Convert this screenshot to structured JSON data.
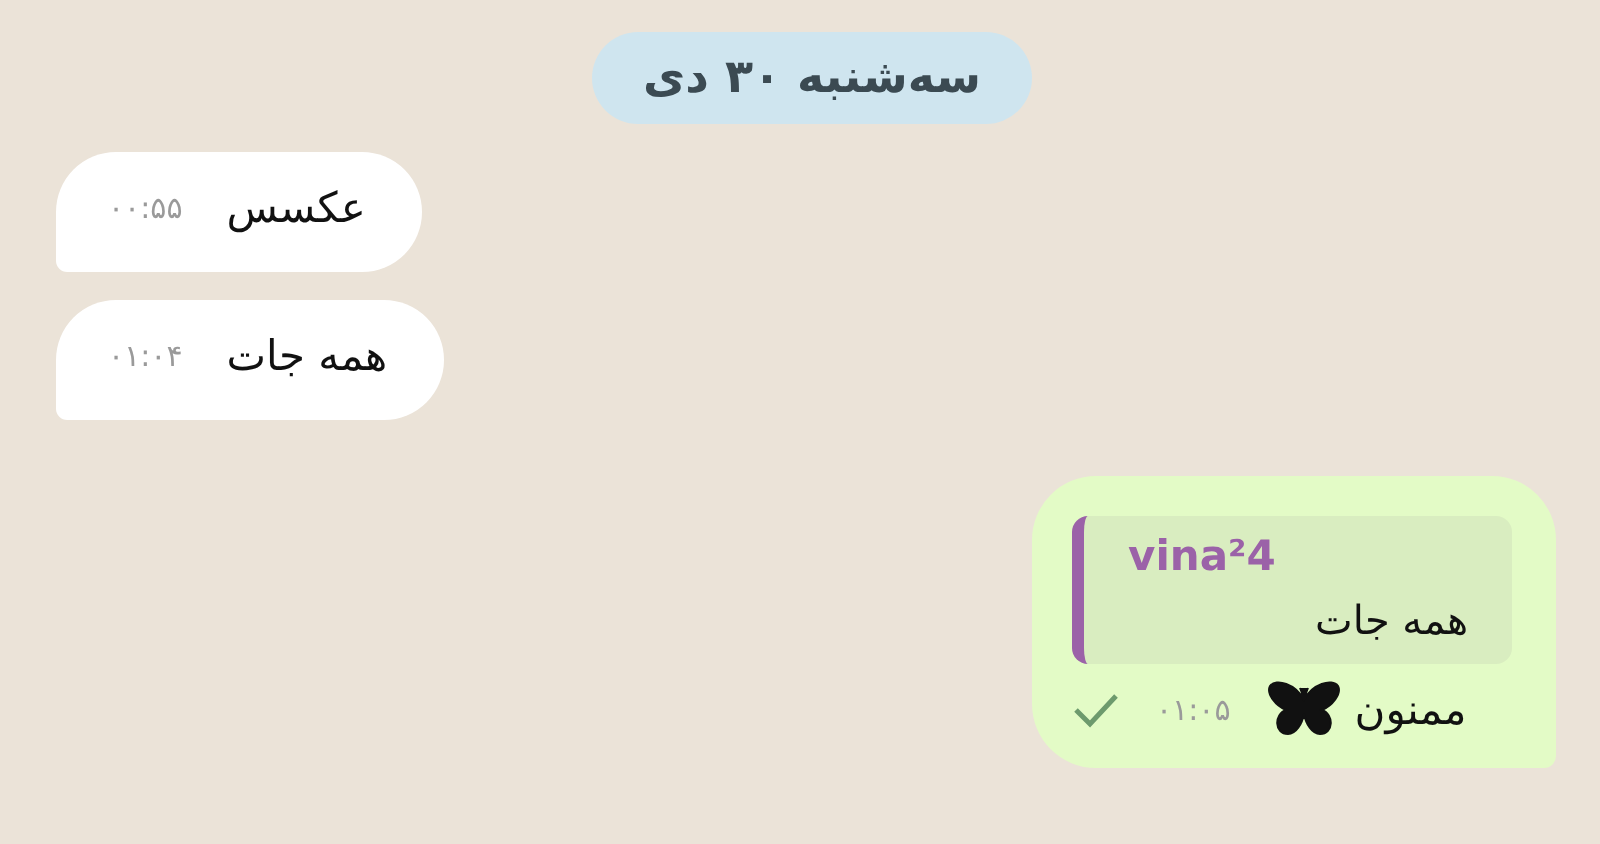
{
  "date_chip": "سه‌شنبه ۳۰ دی",
  "messages": [
    {
      "kind": "incoming",
      "text": "عکسس",
      "time": "۰۰:۵۵"
    },
    {
      "kind": "incoming",
      "text": "همه جات",
      "time": "۰۱:۰۴"
    },
    {
      "kind": "outgoing",
      "reply": {
        "author": "vina²4",
        "text": "همه جات"
      },
      "text": "ممنون",
      "time": "۰۱:۰۵",
      "delivered": true
    }
  ]
}
